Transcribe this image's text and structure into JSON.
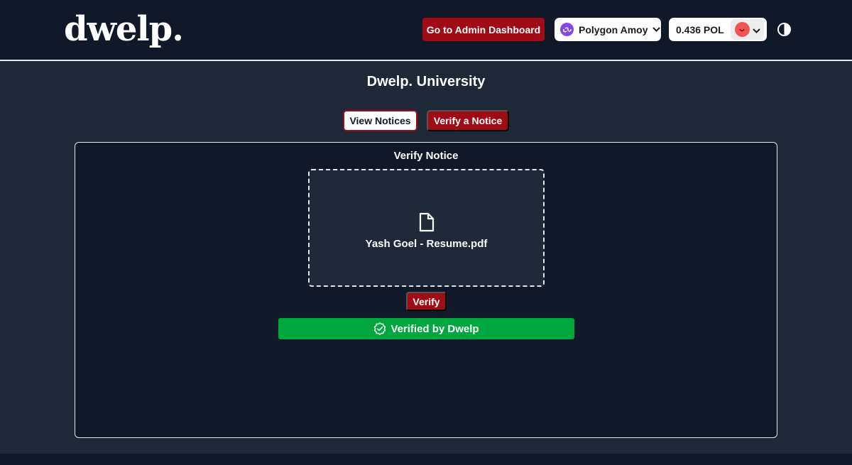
{
  "header": {
    "logo": "dwelp.",
    "admin_button": "Go to Admin Dashboard",
    "network": {
      "name": "Polygon Amoy",
      "icon": "polygon-icon"
    },
    "balance": "0.436 POL",
    "account_icon": "avatar-icon",
    "theme_icon": "half-circle-icon"
  },
  "main": {
    "title": "Dwelp. University",
    "tabs": [
      {
        "label": "View Notices",
        "active": false
      },
      {
        "label": "Verify a Notice",
        "active": true
      }
    ],
    "panel": {
      "title": "Verify Notice",
      "file_icon": "file-icon",
      "file_name": "Yash Goel - Resume.pdf",
      "verify_button": "Verify",
      "status_icon": "check-badge-icon",
      "status_text": "Verified by Dwelp"
    }
  },
  "colors": {
    "accent": "#a00c16",
    "success": "#00a63e",
    "background": "#1e2836",
    "surface": "#111827"
  }
}
